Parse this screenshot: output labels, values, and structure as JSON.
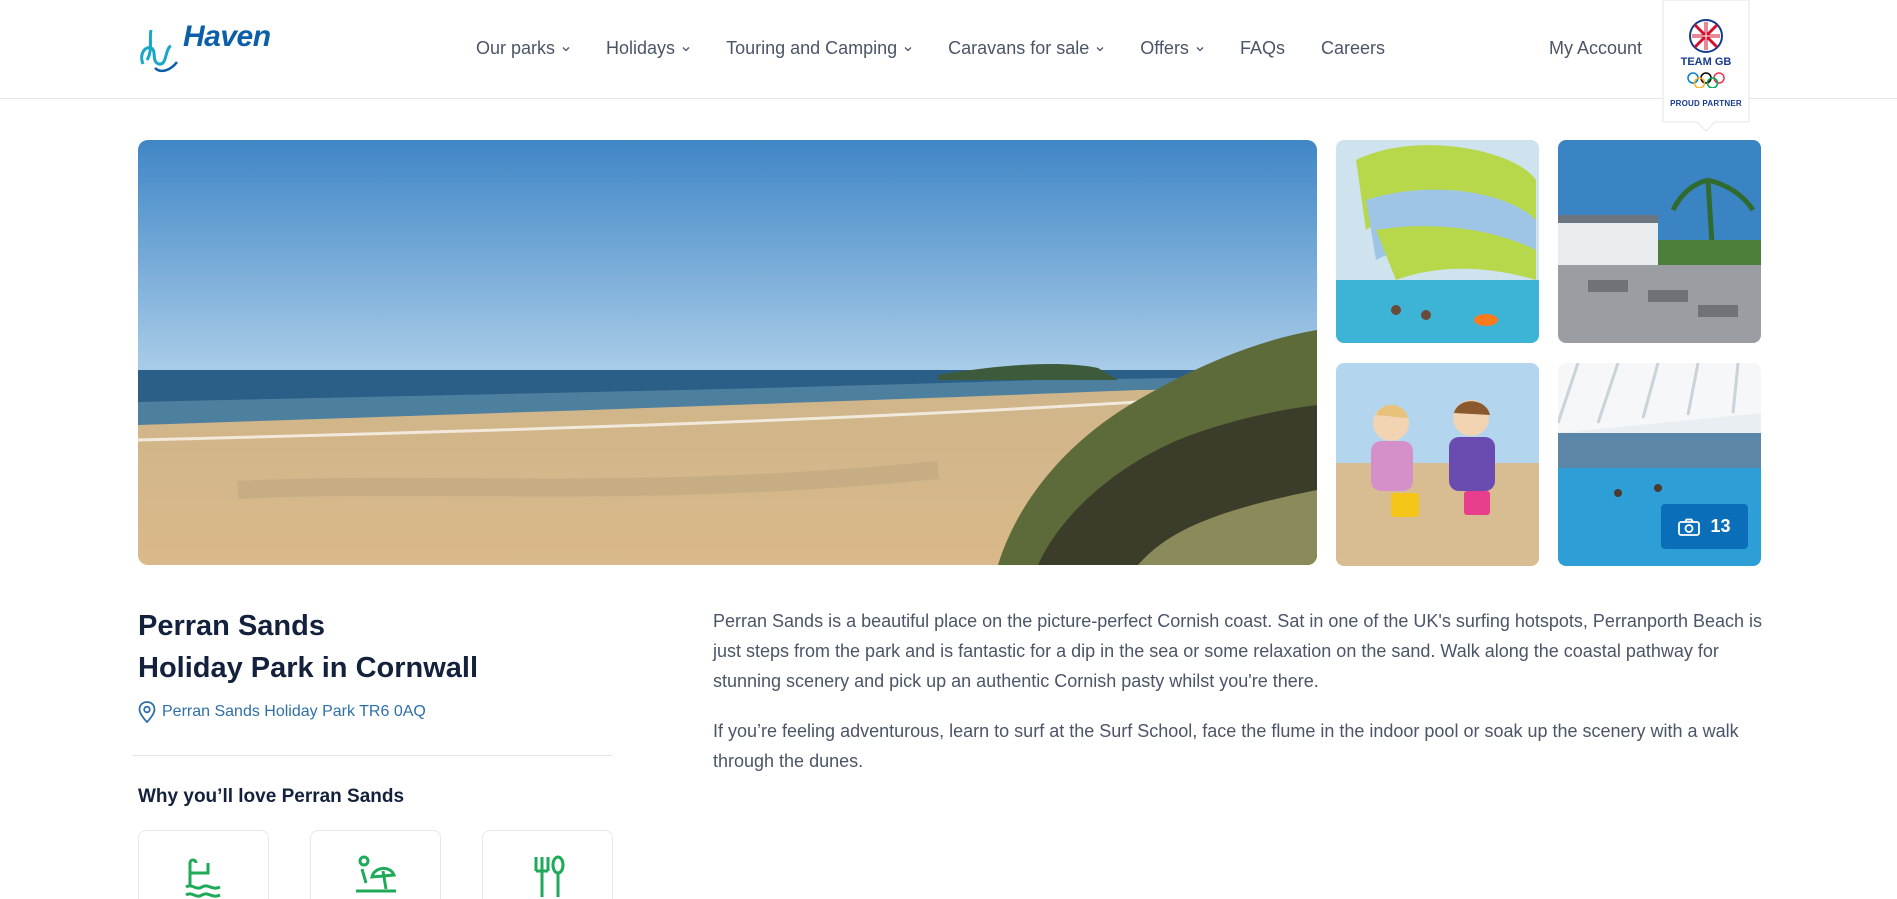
{
  "header": {
    "logo_text": "Haven",
    "nav": [
      {
        "label": "Our parks",
        "dropdown": true
      },
      {
        "label": "Holidays",
        "dropdown": true
      },
      {
        "label": "Touring and Camping",
        "dropdown": true
      },
      {
        "label": "Caravans for sale",
        "dropdown": true
      },
      {
        "label": "Offers",
        "dropdown": true
      },
      {
        "label": "FAQs",
        "dropdown": false
      },
      {
        "label": "Careers",
        "dropdown": false
      }
    ],
    "my_account": "My Account",
    "team_gb": {
      "label": "TEAM GB",
      "partner": "PROUD PARTNER"
    }
  },
  "gallery": {
    "photo_count": "13",
    "camera_icon": "camera-icon"
  },
  "park": {
    "name": "Perran Sands",
    "subtitle": "Holiday Park in Cornwall",
    "address": "Perran Sands Holiday Park TR6 0AQ",
    "why_heading": "Why you’ll love Perran Sands",
    "features": [
      {
        "icon": "pool-icon"
      },
      {
        "icon": "beach-icon"
      },
      {
        "icon": "food-icon"
      }
    ]
  },
  "description": {
    "paragraphs": [
      "Perran Sands is a beautiful place on the picture-perfect Cornish coast. Sat in one of the UK's surfing hotspots, Perranporth Beach is just steps from the park and is fantastic for a dip in the sea or some relaxation on the sand. Walk along the coastal pathway for stunning scenery and pick up an authentic Cornish pasty whilst you're there.",
      "If you’re feeling adventurous, learn to surf at the Surf School, face the flume in the indoor pool or soak up the scenery with a walk through the dunes."
    ]
  },
  "colors": {
    "brand_blue": "#0a5fa8",
    "button_blue": "#0a6fb8",
    "feature_green": "#1faa59",
    "heading": "#14213d"
  }
}
